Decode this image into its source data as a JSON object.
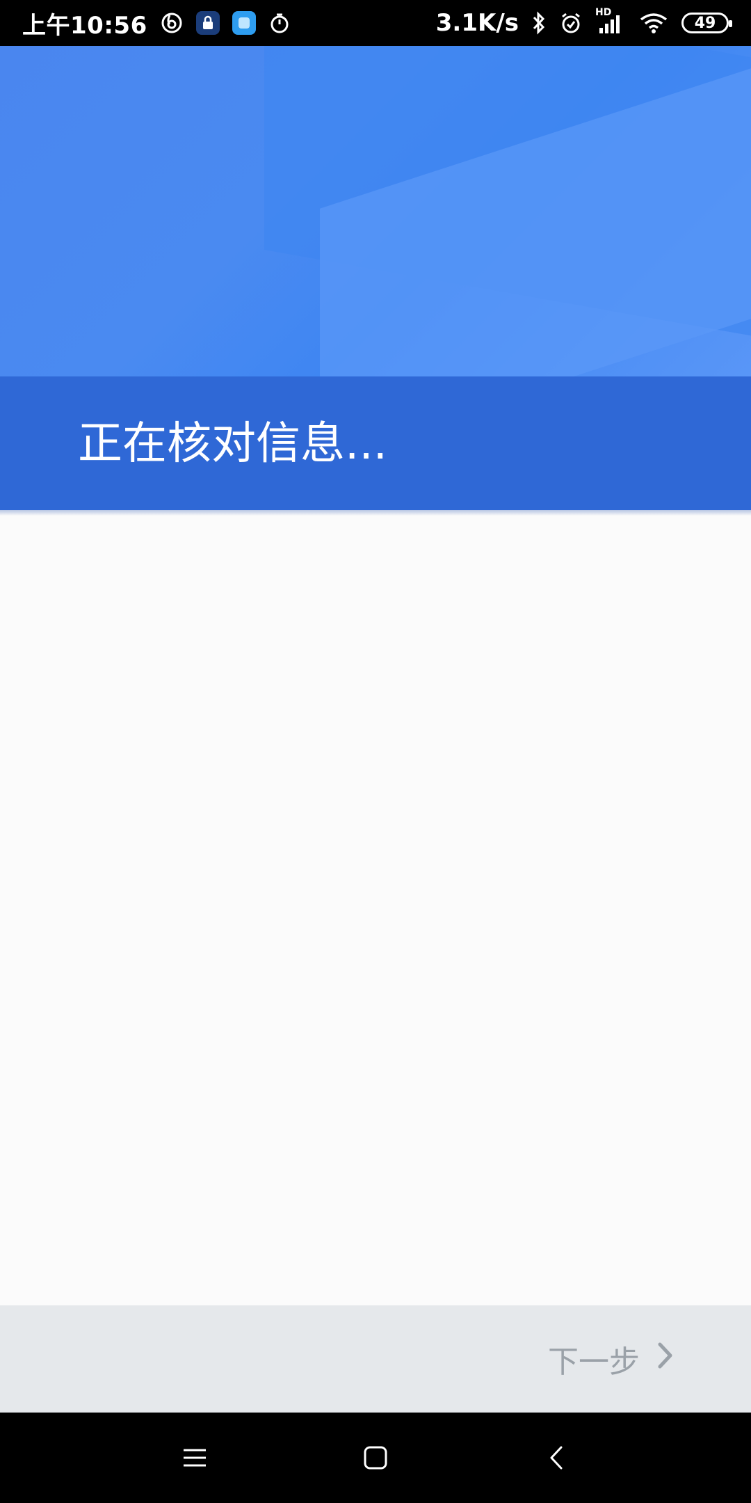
{
  "status_bar": {
    "time": "上午10:56",
    "net_speed": "3.1K/s",
    "hd_label": "HD",
    "battery": "49"
  },
  "header": {
    "title": "正在核对信息..."
  },
  "footer": {
    "next_label": "下一步"
  },
  "icons": {
    "status_left": [
      "netease-music-icon",
      "app-lock-icon",
      "app-blue-icon",
      "timer-icon"
    ],
    "status_right": [
      "bluetooth-icon",
      "alarm-icon",
      "signal-icon",
      "wifi-icon"
    ],
    "nav": [
      "menu-icon",
      "home-icon",
      "back-icon"
    ],
    "next": "chevron-right-icon"
  },
  "colors": {
    "header_blue": "#4a86ef",
    "titlebar_blue": "#2f68d6",
    "footer_bg": "#e5e8eb",
    "next_text": "#9aa1a8"
  }
}
